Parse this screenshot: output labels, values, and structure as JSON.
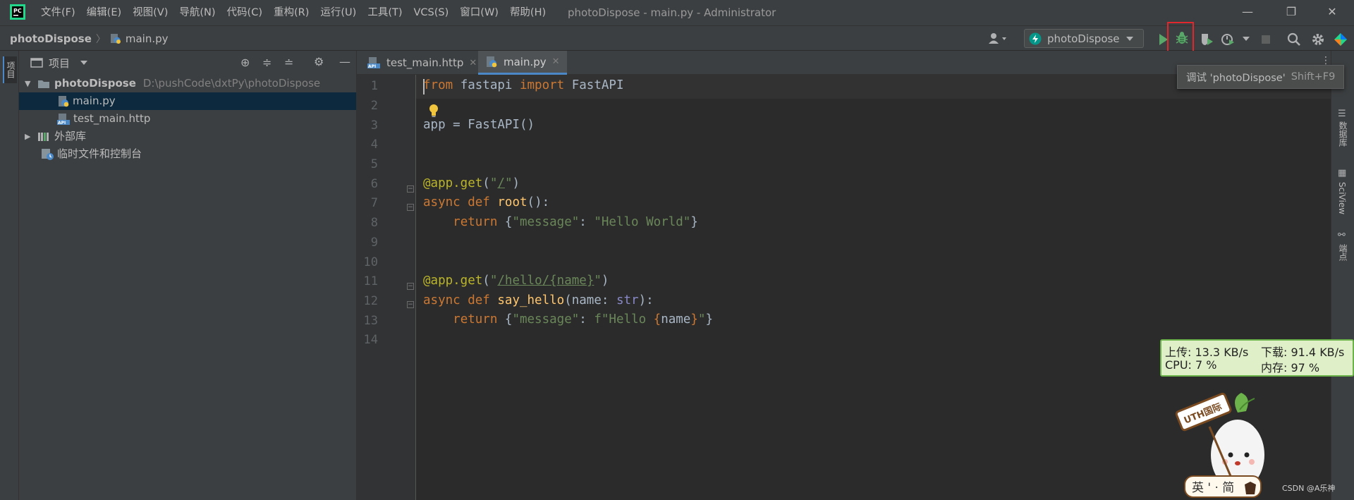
{
  "titlebar": {
    "menus": [
      "文件(F)",
      "编辑(E)",
      "视图(V)",
      "导航(N)",
      "代码(C)",
      "重构(R)",
      "运行(U)",
      "工具(T)",
      "VCS(S)",
      "窗口(W)",
      "帮助(H)"
    ],
    "window_title": "photoDispose - main.py - Administrator",
    "minimize": "—",
    "restore": "❐",
    "close": "✕"
  },
  "navbar": {
    "project": "photoDispose",
    "separator": "〉",
    "file": "main.py"
  },
  "toolbar": {
    "run_config": "photoDispose",
    "tooltip_label": "调试 'photoDispose'",
    "tooltip_shortcut": "Shift+F9"
  },
  "left_stripe": {
    "project_tab": "项目"
  },
  "project_panel": {
    "header": "项目",
    "tree": [
      {
        "name": "photoDispose",
        "path": "D:\\pushCode\\dxtPy\\photoDispose"
      },
      {
        "name": "main.py"
      },
      {
        "name": "test_main.http"
      },
      {
        "name": "外部库"
      },
      {
        "name": "临时文件和控制台"
      }
    ]
  },
  "editor": {
    "tabs": [
      {
        "label": "test_main.http",
        "active": false
      },
      {
        "label": "main.py",
        "active": true
      }
    ],
    "line_numbers": [
      "1",
      "2",
      "3",
      "4",
      "5",
      "6",
      "7",
      "8",
      "9",
      "10",
      "11",
      "12",
      "13",
      "14"
    ],
    "code": {
      "l1": {
        "kw1": "from",
        "mod": " fastapi ",
        "kw2": "import",
        "name": " FastAPI"
      },
      "l3": {
        "text": "app = FastAPI()"
      },
      "l6": {
        "deco": "@app.get",
        "p1": "(",
        "q1": "\"",
        "path": "/",
        "q2": "\"",
        "p2": ")"
      },
      "l7": {
        "kw1": "async",
        "kw2": " def ",
        "fn": "root",
        "rest": "():"
      },
      "l8": {
        "indent": "    ",
        "kw": "return",
        "b1": " {",
        "key": "\"message\"",
        "colon": ": ",
        "val": "\"Hello World\"",
        "b2": "}"
      },
      "l11": {
        "deco": "@app.get",
        "p1": "(",
        "q1": "\"",
        "path": "/hello/{name}",
        "q2": "\"",
        "p2": ")"
      },
      "l12": {
        "kw1": "async",
        "kw2": " def ",
        "fn": "say_hello",
        "p1": "(name: ",
        "type": "str",
        "p2": "):"
      },
      "l13": {
        "indent": "    ",
        "kw": "return",
        "b1": " {",
        "key": "\"message\"",
        "colon": ": ",
        "f": "f\"Hello ",
        "lb": "{",
        "var": "name",
        "rb": "}",
        "fq": "\"",
        "b2": "}"
      }
    }
  },
  "right_stripe": [
    "数据库",
    "SciView",
    "端点"
  ],
  "netmon": {
    "upload": "上传: 13.3 KB/s",
    "download": "下载: 91.4 KB/s",
    "cpu": "CPU: 7 %",
    "memory": "内存: 97 %"
  },
  "mascot": {
    "sign": "UTH国际",
    "bar": "英 ' · 简"
  },
  "watermark": "CSDN @A乐神",
  "colors": {
    "accent": "#4a88c7",
    "highlight_box": "#e0272e",
    "run_green": "#59a869",
    "keyword": "#cc7832",
    "string": "#6a8759",
    "decorator": "#bbb529",
    "function": "#ffc66d"
  }
}
